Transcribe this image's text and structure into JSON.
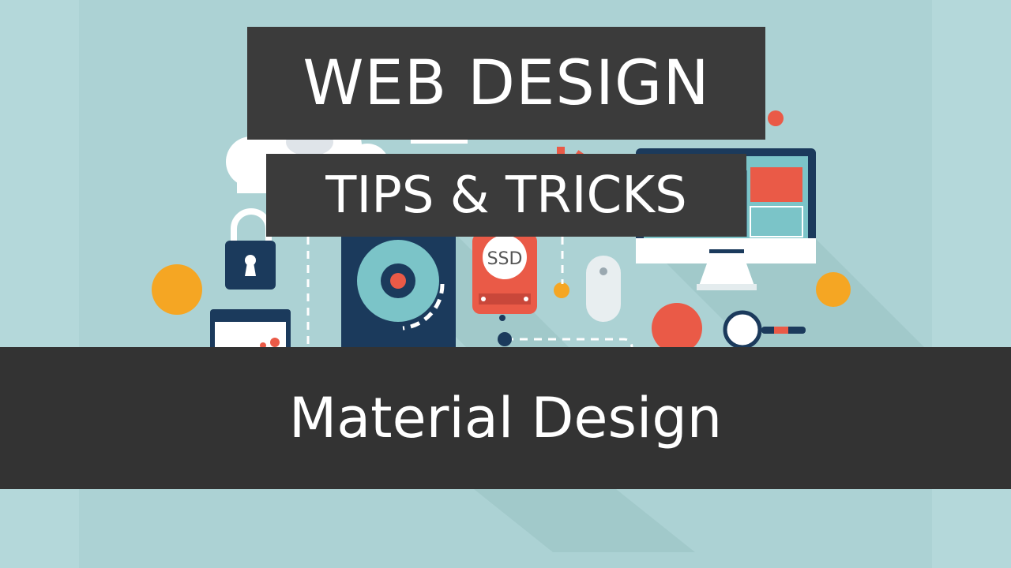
{
  "thumbnail": {
    "title": "WEB DESIGN",
    "subtitle": "TIPS & TRICKS",
    "topic": "Material Design",
    "ssd_label": "SSD"
  },
  "colors": {
    "background": "#acd2d4",
    "banner_dark": "#3b3b3b",
    "bar_dark": "#333333",
    "navy": "#1b3a5c",
    "red": "#ea5a47",
    "orange": "#f5a623",
    "teal": "#7bc4c8",
    "white": "#ffffff"
  },
  "icons": [
    "cloud-icon",
    "padlock-icon",
    "hard-drive-icon",
    "ssd-icon",
    "mouse-icon",
    "monitor-icon",
    "magnifier-icon",
    "gear-icon",
    "browser-window-icon"
  ]
}
